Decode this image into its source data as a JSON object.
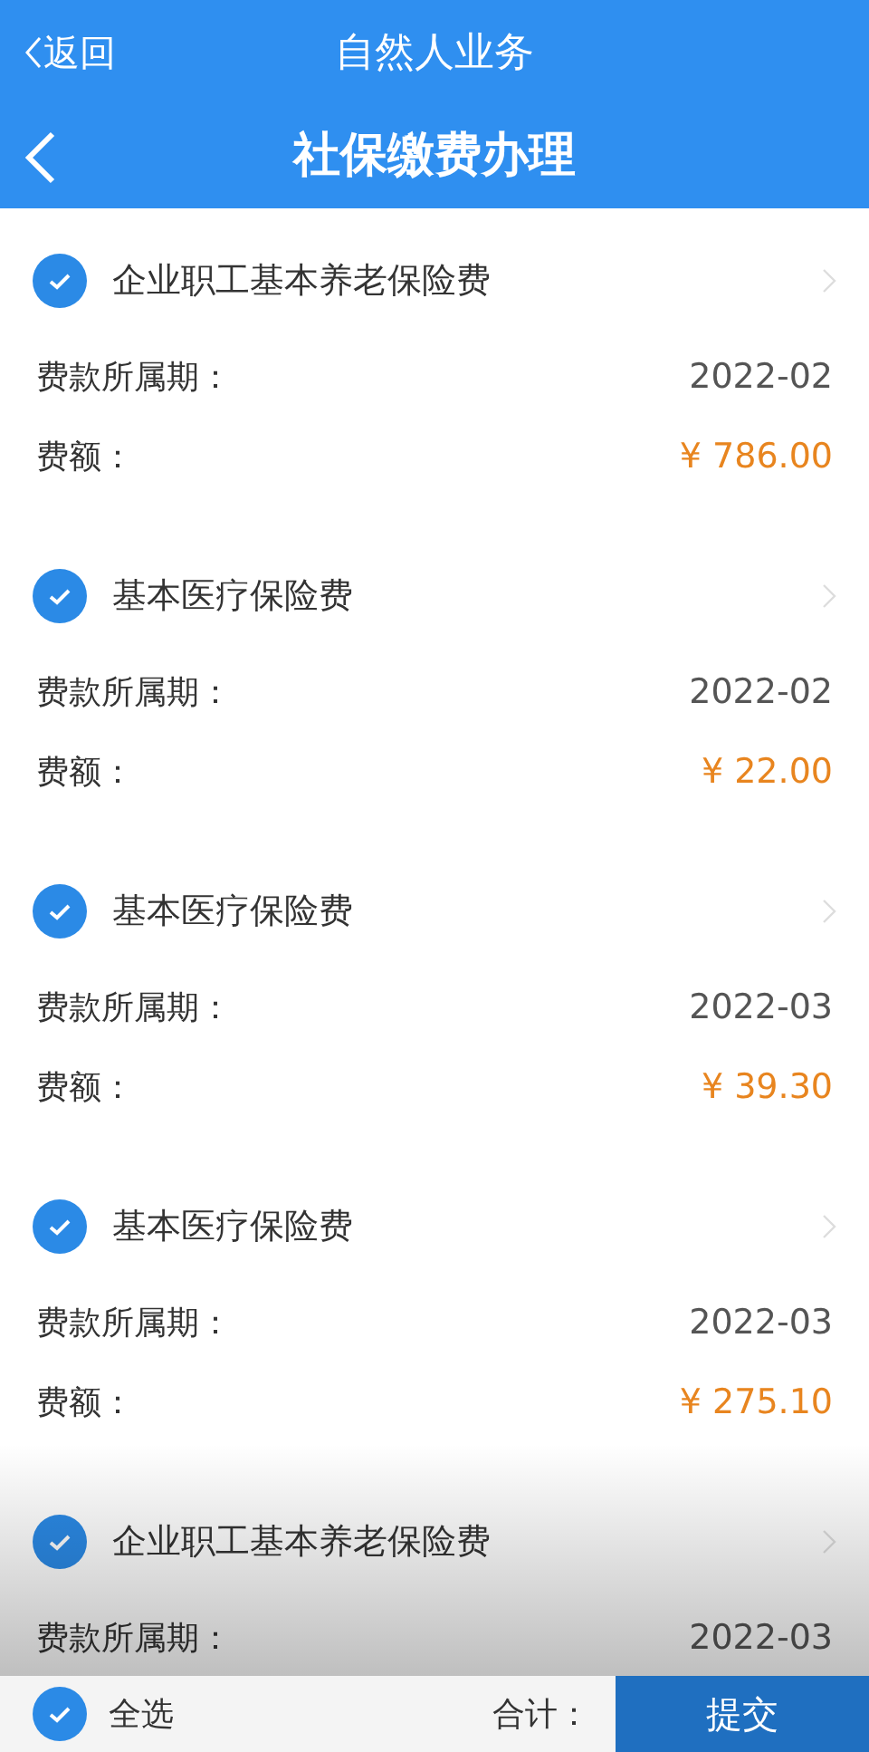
{
  "status_row": {
    "back_label": "返回",
    "title": "自然人业务"
  },
  "nav_bar": {
    "title": "社保缴费办理"
  },
  "items": [
    {
      "name": "企业职工基本养老保险费",
      "checked": true,
      "period_label": "费款所属期：",
      "period": "2022-02",
      "amount_label": "费额：",
      "amount": "¥ 786.00"
    },
    {
      "name": "基本医疗保险费",
      "checked": true,
      "period_label": "费款所属期：",
      "period": "2022-02",
      "amount_label": "费额：",
      "amount": "¥ 22.00"
    },
    {
      "name": "基本医疗保险费",
      "checked": true,
      "period_label": "费款所属期：",
      "period": "2022-03",
      "amount_label": "费额：",
      "amount": "¥ 39.30"
    },
    {
      "name": "基本医疗保险费",
      "checked": true,
      "period_label": "费款所属期：",
      "period": "2022-03",
      "amount_label": "费额：",
      "amount": "¥ 275.10"
    },
    {
      "name": "企业职工基本养老保险费",
      "checked": true,
      "period_label": "费款所属期：",
      "period": "2022-03"
    }
  ],
  "footer": {
    "select_all": "全选",
    "select_all_checked": true,
    "total_label": "合计：",
    "submit": "提交"
  }
}
